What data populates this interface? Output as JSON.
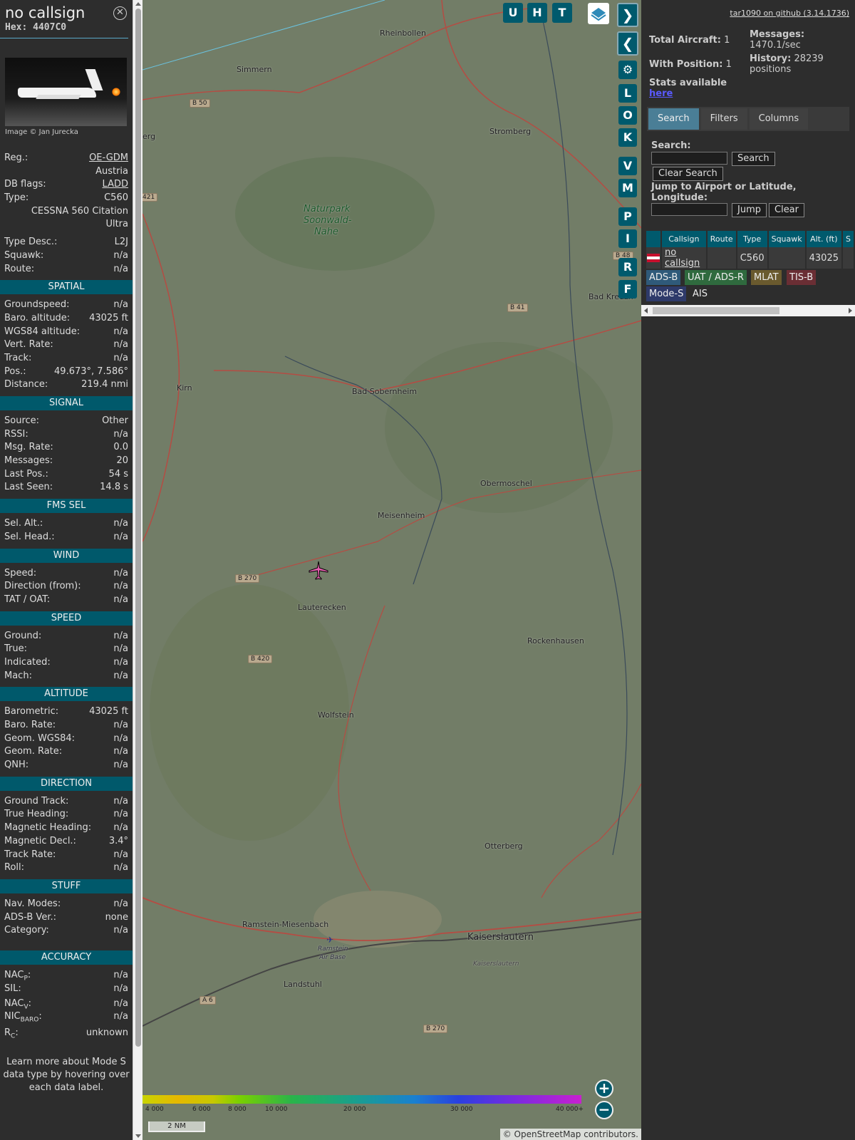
{
  "selected": {
    "callsign": "no callsign",
    "hex": "Hex: 4407C0",
    "image_credit": "Image © Jan Jurecka",
    "reg_label": "Reg.:",
    "reg": "OE-GDM",
    "country": "Austria",
    "dbflags_label": "DB flags:",
    "dbflags": "LADD",
    "type_label": "Type:",
    "type": "C560",
    "type_full_1": "CESSNA 560 Citation",
    "type_full_2": "Ultra",
    "typedesc_label": "Type Desc.:",
    "typedesc": "L2J",
    "squawk_label": "Squawk:",
    "squawk": "n/a",
    "route_label": "Route:",
    "route": "n/a"
  },
  "sections": [
    {
      "title": "SPATIAL",
      "rows": [
        [
          "Groundspeed:",
          "n/a"
        ],
        [
          "Baro. altitude:",
          "43025 ft"
        ],
        [
          "WGS84 altitude:",
          "n/a"
        ],
        [
          "Vert. Rate:",
          "n/a"
        ],
        [
          "Track:",
          "n/a"
        ],
        [
          "Pos.:",
          "49.673°, 7.586°"
        ],
        [
          "Distance:",
          "219.4 nmi"
        ]
      ]
    },
    {
      "title": "SIGNAL",
      "rows": [
        [
          "Source:",
          "Other"
        ],
        [
          "RSSI:",
          "n/a"
        ],
        [
          "Msg. Rate:",
          "0.0"
        ],
        [
          "Messages:",
          "20"
        ],
        [
          "Last Pos.:",
          "54 s"
        ],
        [
          "Last Seen:",
          "14.8 s"
        ]
      ]
    },
    {
      "title": "FMS SEL",
      "rows": [
        [
          "Sel. Alt.:",
          "n/a"
        ],
        [
          "Sel. Head.:",
          "n/a"
        ]
      ]
    },
    {
      "title": "WIND",
      "rows": [
        [
          "Speed:",
          "n/a"
        ],
        [
          "Direction (from):",
          "n/a"
        ],
        [
          "TAT / OAT:",
          "n/a"
        ]
      ]
    },
    {
      "title": "SPEED",
      "rows": [
        [
          "Ground:",
          "n/a"
        ],
        [
          "True:",
          "n/a"
        ],
        [
          "Indicated:",
          "n/a"
        ],
        [
          "Mach:",
          "n/a"
        ]
      ]
    },
    {
      "title": "ALTITUDE",
      "rows": [
        [
          "Barometric:",
          "43025 ft"
        ],
        [
          "Baro. Rate:",
          "n/a"
        ],
        [
          "Geom. WGS84:",
          "n/a"
        ],
        [
          "Geom. Rate:",
          "n/a"
        ],
        [
          "QNH:",
          "n/a"
        ]
      ]
    },
    {
      "title": "DIRECTION",
      "rows": [
        [
          "Ground Track:",
          "n/a"
        ],
        [
          "True Heading:",
          "n/a"
        ],
        [
          "Magnetic Heading:",
          "n/a"
        ],
        [
          "Magnetic Decl.:",
          "3.4°"
        ],
        [
          "Track Rate:",
          "n/a"
        ],
        [
          "Roll:",
          "n/a"
        ]
      ]
    },
    {
      "title": "STUFF",
      "rows": [
        [
          "Nav. Modes:",
          "n/a"
        ],
        [
          "ADS-B Ver.:",
          "none"
        ],
        [
          "Category:",
          "n/a"
        ]
      ]
    }
  ],
  "accuracy": {
    "title": "ACCURACY",
    "nacp": "NAC",
    "nacp_sub": "P",
    "nacp_val": "n/a",
    "sil": "SIL:",
    "sil_val": "n/a",
    "nacv": "NAC",
    "nacv_sub": "V",
    "nacv_val": "n/a",
    "nicbaro": "NIC",
    "nicbaro_sub": "BARO",
    "nicbaro_val": "n/a",
    "rc": "R",
    "rc_sub": "C",
    "rc_val": "unknown",
    "colon": ":"
  },
  "learn_more": "Learn more about Mode S data type by hovering over each data label.",
  "map": {
    "top_buttons": [
      "U",
      "H",
      "T"
    ],
    "side_buttons": [
      "L",
      "O",
      "K",
      "V",
      "M",
      "P",
      "I",
      "R",
      "F"
    ],
    "places": [
      "Rheinbollen",
      "Simmern",
      "Stromberg",
      "Naturpark",
      "Soonwald-",
      "Nahe",
      "Kirn",
      "Bad Sobernheim",
      "Obermoschel",
      "Meisenheim",
      "Lauterecken",
      "Rockenhausen",
      "Wolfstein",
      "Otterberg",
      "Ramstein-Miesenbach",
      "Kaiserslautern",
      "Ramstein",
      "Air Base",
      "Landstuhl",
      "Kaiserslautern",
      "Bad Kreuzn",
      "erg"
    ],
    "roads": [
      "B 50",
      "421",
      "B 41",
      "B 270",
      "B 420",
      "A 6",
      "B 270",
      "B 48"
    ],
    "colorbar_labels": [
      "4 000",
      "6 000",
      "8 000",
      "10 000",
      "20 000",
      "30 000",
      "40 000+"
    ],
    "scale": "2 NM",
    "attribution": "© OpenStreetMap contributors."
  },
  "sidebar": {
    "github": "tar1090 on github (3.14.1736)",
    "total_label": "Total Aircraft:",
    "total": "1",
    "withpos_label": "With Position:",
    "withpos": "1",
    "messages_label": "Messages:",
    "messages": "1470.1/sec",
    "history_label": "History:",
    "history": "28239",
    "history_unit": "positions",
    "stats_label": "Stats available",
    "stats_link": "here",
    "tabs": [
      "Search",
      "Filters",
      "Columns"
    ],
    "search_label": "Search:",
    "search_btn": "Search",
    "clear_search_btn": "Clear Search",
    "jump_label": "Jump to Airport or Latitude, Longitude:",
    "jump_btn": "Jump",
    "clear_btn": "Clear",
    "columns": [
      "Callsign",
      "Route",
      "Type",
      "Squawk",
      "Alt. (ft)",
      "S"
    ],
    "row": {
      "callsign": "no callsign",
      "route": "",
      "type": "C560",
      "squawk": "",
      "alt": "43025"
    },
    "legend": [
      "ADS-B",
      "UAT / ADS-R",
      "MLAT",
      "TIS-B",
      "Mode-S",
      "AIS"
    ]
  }
}
